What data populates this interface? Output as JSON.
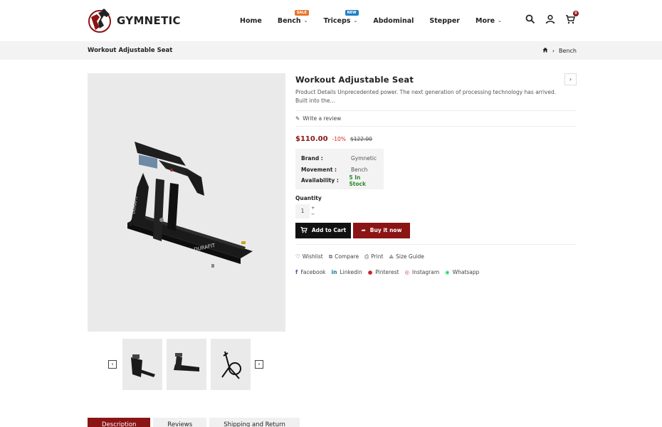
{
  "brand": {
    "name": "GYMNETIC"
  },
  "nav": {
    "items": [
      {
        "label": "Home"
      },
      {
        "label": "Bench",
        "badge": "SALE"
      },
      {
        "label": "Triceps",
        "badge": "NEW"
      },
      {
        "label": "Abdominal"
      },
      {
        "label": "Stepper"
      },
      {
        "label": "More"
      }
    ]
  },
  "header": {
    "cart_count": "0",
    "icons": [
      "search-icon",
      "user-icon",
      "cart-icon"
    ]
  },
  "breadcrumb": {
    "title": "Workout Adjustable Seat",
    "current": "Bench"
  },
  "product": {
    "title": "Workout Adjustable Seat",
    "description": "Product Details Unprecedented power. The next generation of processing technology has arrived. Built into the...",
    "review_link": "Write a review",
    "price": "$110.00",
    "discount": "-10%",
    "old_price": "$122.00",
    "meta": [
      {
        "label": "Brand :",
        "value": "Gymnetic"
      },
      {
        "label": "Movement :",
        "value": "Bench"
      },
      {
        "label": "Availability :",
        "value": "5 In Stock"
      }
    ],
    "quantity_label": "Quantity",
    "quantity": "1",
    "add_to_cart": "Add to Cart",
    "buy_now": "Buy it now",
    "links": [
      "Wishlist",
      "Compare",
      "Print",
      "Size Guide"
    ],
    "social": [
      "Facebook",
      "Linkedin",
      "Pinterest",
      "Instagram",
      "Whatsapp"
    ],
    "main_image_text": "DURAFIT"
  },
  "tabs": [
    "Description",
    "Reviews",
    "Shipping and Return"
  ],
  "colors": {
    "accent": "#8b1414",
    "dark": "#111111",
    "stock": "#2b8a2b",
    "discount": "#d9271e"
  }
}
